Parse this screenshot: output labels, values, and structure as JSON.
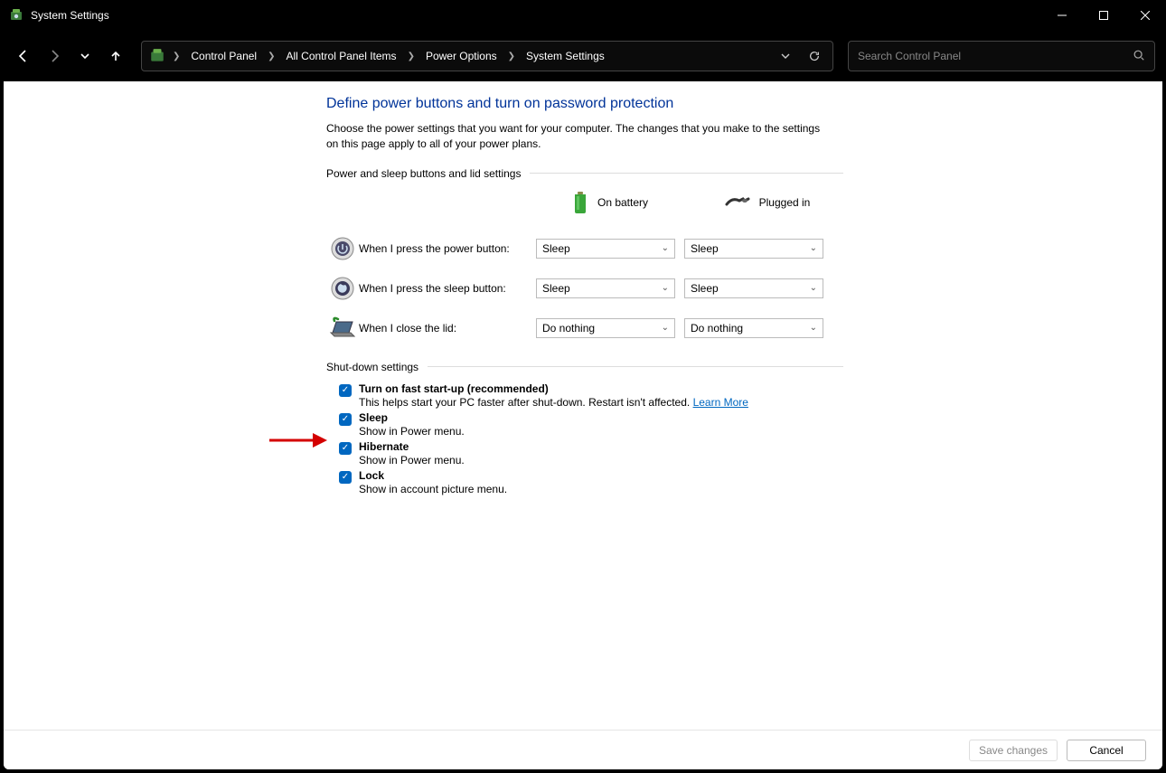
{
  "window": {
    "title": "System Settings"
  },
  "breadcrumbs": {
    "items": [
      "Control Panel",
      "All Control Panel Items",
      "Power Options",
      "System Settings"
    ]
  },
  "search": {
    "placeholder": "Search Control Panel"
  },
  "page": {
    "title": "Define power buttons and turn on password protection",
    "description": "Choose the power settings that you want for your computer. The changes that you make to the settings on this page apply to all of your power plans."
  },
  "section1": {
    "label": "Power and sleep buttons and lid settings",
    "col_battery": "On battery",
    "col_plugged": "Plugged in",
    "rows": [
      {
        "label": "When I press the power button:",
        "battery": "Sleep",
        "plugged": "Sleep"
      },
      {
        "label": "When I press the sleep button:",
        "battery": "Sleep",
        "plugged": "Sleep"
      },
      {
        "label": "When I close the lid:",
        "battery": "Do nothing",
        "plugged": "Do nothing"
      }
    ]
  },
  "section2": {
    "label": "Shut-down settings",
    "items": [
      {
        "title": "Turn on fast start-up (recommended)",
        "sub": "This helps start your PC faster after shut-down. Restart isn't affected. ",
        "learn": "Learn More",
        "checked": true
      },
      {
        "title": "Sleep",
        "sub": "Show in Power menu.",
        "checked": true
      },
      {
        "title": "Hibernate",
        "sub": "Show in Power menu.",
        "checked": true
      },
      {
        "title": "Lock",
        "sub": "Show in account picture menu.",
        "checked": true
      }
    ]
  },
  "footer": {
    "save": "Save changes",
    "cancel": "Cancel"
  }
}
